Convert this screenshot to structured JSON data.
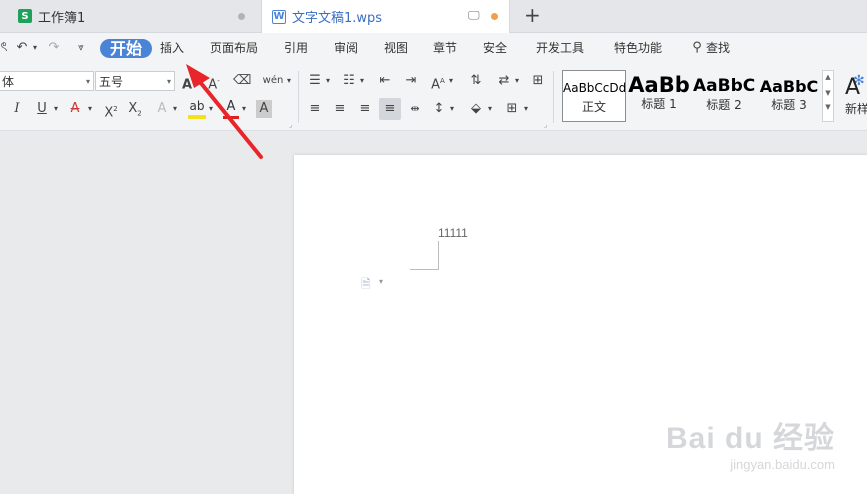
{
  "tabs": [
    {
      "label": "工作簿1",
      "icon": "S"
    },
    {
      "label": "文字文稿1.wps",
      "icon": "W"
    }
  ],
  "colors": {
    "accent": "#4a84d6",
    "unsaved_dot": "#f0a04b",
    "arrow": "#e8252a"
  },
  "menu": {
    "start": "开始",
    "insert": "插入",
    "page_layout": "页面布局",
    "references": "引用",
    "review": "审阅",
    "view": "视图",
    "section": "章节",
    "security": "安全",
    "dev_tools": "开发工具",
    "special": "特色功能",
    "search": "查找"
  },
  "font": {
    "family": "体",
    "size": "五号"
  },
  "phonetic_glyph": "wén",
  "styles": [
    {
      "sample": "AaBbCcDd",
      "name": "正文"
    },
    {
      "sample": "AaBb",
      "name": "标题 1"
    },
    {
      "sample": "AaBbC",
      "name": "标题 2"
    },
    {
      "sample": "AaBbC",
      "name": "标题 3"
    }
  ],
  "new_style": "新样",
  "document": {
    "text": "11111"
  },
  "watermark": {
    "brand": "Bai du 经验",
    "url": "jingyan.baidu.com"
  }
}
